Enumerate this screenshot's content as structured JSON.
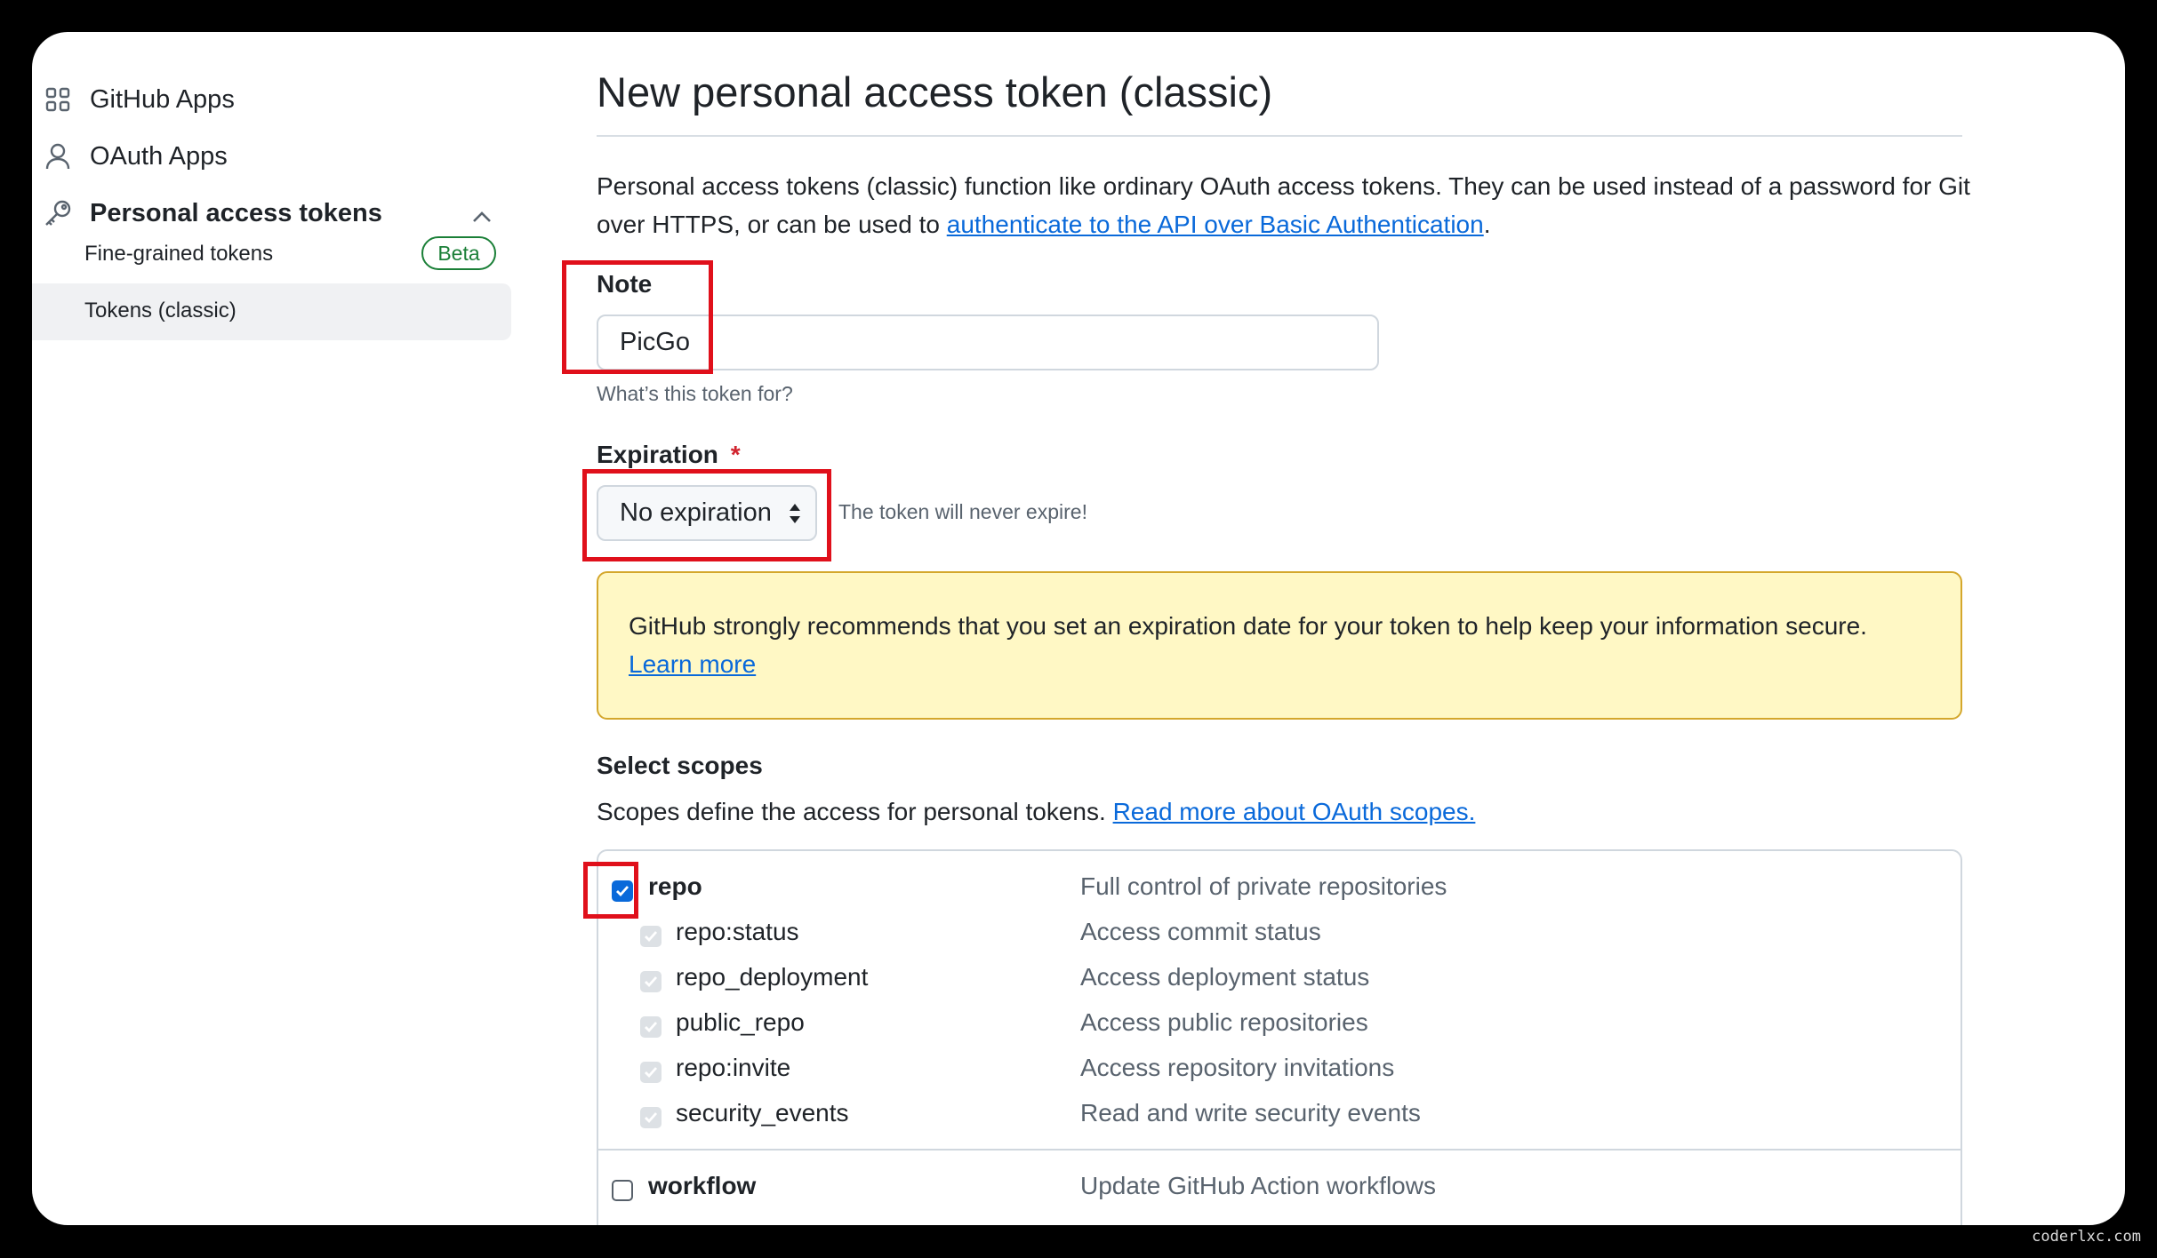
{
  "sidebar": {
    "items": [
      {
        "label": "GitHub Apps",
        "icon": "apps-grid-icon"
      },
      {
        "label": "OAuth Apps",
        "icon": "person-icon"
      },
      {
        "label": "Personal access tokens",
        "icon": "key-icon"
      }
    ],
    "sub_items": [
      {
        "label": "Fine-grained tokens",
        "badge": "Beta"
      },
      {
        "label": "Tokens (classic)",
        "active": true
      }
    ]
  },
  "main": {
    "title": "New personal access token (classic)",
    "intro_prefix": "Personal access tokens (classic) function like ordinary OAuth access tokens. They can be used instead of a password for Git over HTTPS, or can be used to ",
    "intro_link": "authenticate to the API over Basic Authentication",
    "intro_suffix": ".",
    "note_label": "Note",
    "note_value": "PicGo",
    "note_hint": "What’s this token for?",
    "expiration_label": "Expiration",
    "required_mark": "*",
    "expiration_value": "No expiration",
    "expiration_hint": "The token will never expire!",
    "flash_text": "GitHub strongly recommends that you set an expiration date for your token to help keep your information secure.",
    "flash_link": "Learn more",
    "scopes_heading": "Select scopes",
    "scopes_intro": "Scopes define the access for personal tokens.",
    "scopes_link": "Read more about OAuth scopes.",
    "scopes": [
      {
        "name": "repo",
        "desc": "Full control of private repositories",
        "state": "checked",
        "bold": true
      },
      {
        "name": "repo:status",
        "desc": "Access commit status",
        "state": "disabled"
      },
      {
        "name": "repo_deployment",
        "desc": "Access deployment status",
        "state": "disabled"
      },
      {
        "name": "public_repo",
        "desc": "Access public repositories",
        "state": "disabled"
      },
      {
        "name": "repo:invite",
        "desc": "Access repository invitations",
        "state": "disabled"
      },
      {
        "name": "security_events",
        "desc": "Read and write security events",
        "state": "disabled"
      },
      {
        "name": "workflow",
        "desc": "Update GitHub Action workflows",
        "state": "unchecked",
        "bold": true
      }
    ]
  },
  "watermark": "coderlxc.com",
  "colors": {
    "accent": "#0969da",
    "highlight": "#e0101b",
    "flash_bg": "#fff8c5",
    "success": "#1a7f37"
  }
}
